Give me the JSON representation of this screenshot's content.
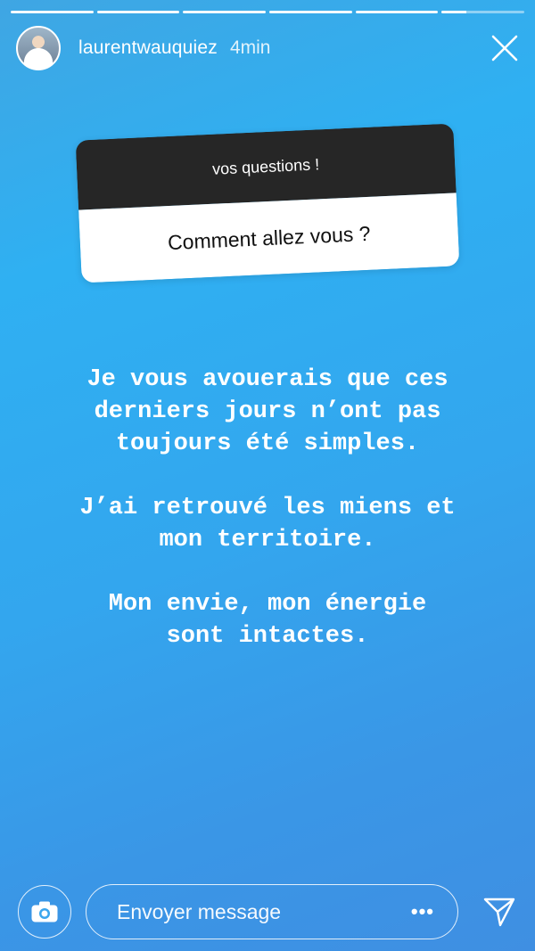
{
  "story": {
    "username": "laurentwauquiez",
    "time": "4min",
    "progress_segments": [
      1,
      1,
      1,
      1,
      1,
      0.3
    ]
  },
  "question_sticker": {
    "title": "vos questions !",
    "question": "Comment allez vous ?"
  },
  "story_text": {
    "paragraph1": "Je vous avouerais que ces\nderniers jours n’ont pas\ntoujours été simples.",
    "paragraph2": "J’ai retrouvé les miens et\nmon territoire.",
    "paragraph3": "Mon envie, mon énergie\nsont intactes."
  },
  "footer": {
    "message_placeholder": "Envoyer message",
    "more_label": "•••"
  },
  "icons": {
    "close": "close-icon",
    "camera": "camera-icon",
    "send": "send-icon"
  }
}
